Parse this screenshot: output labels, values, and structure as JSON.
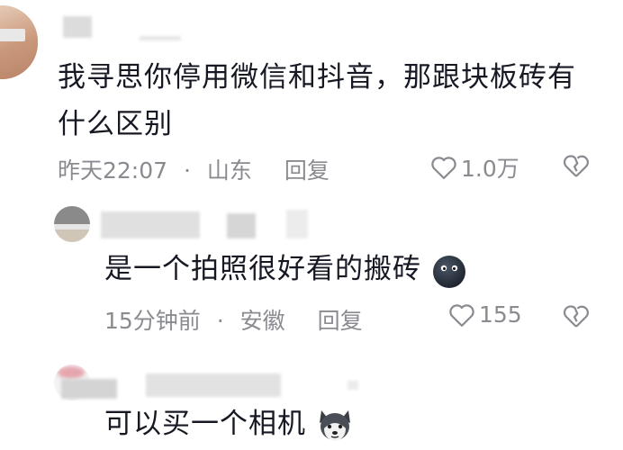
{
  "comments": [
    {
      "text_line1": "我寻思你停用微信和抖音，那跟块板砖有",
      "text_line2": "什么区别",
      "time": "昨天22:07",
      "location": "山东",
      "reply_label": "回复",
      "likes": "1.0万"
    },
    {
      "text": "是一个拍照很好看的搬砖",
      "emoji": "dark-blob-emoji",
      "time": "15分钟前",
      "location": "安徽",
      "reply_label": "回复",
      "likes": "155"
    },
    {
      "text": "可以买一个相机",
      "emoji": "husky-dog-emoji"
    }
  ],
  "separator": "·",
  "icons": {
    "like": "heart-outline-icon",
    "dislike": "broken-heart-icon"
  },
  "colors": {
    "text": "#161823",
    "meta": "#8a8b91",
    "background": "#ffffff"
  }
}
